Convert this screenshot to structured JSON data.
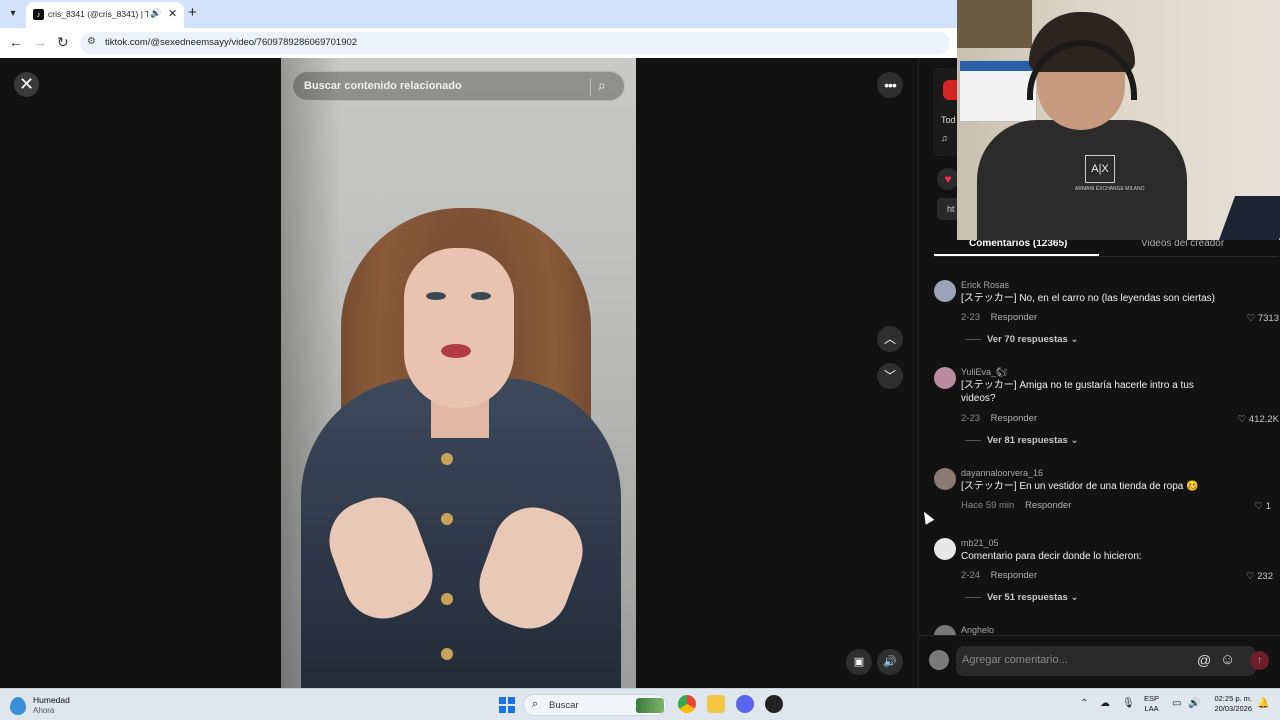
{
  "browser": {
    "tab_title": "cris_8341 (@cris_8341) | Ti",
    "url": "tiktok.com/@sexedneemsayy/video/7609789286069701902"
  },
  "viewer": {
    "search_placeholder": "Buscar contenido relacionado"
  },
  "panel": {
    "partial_text_1": "Tod",
    "partial_text_2": "♫",
    "partial_link": "ht",
    "tabs": [
      "Comentarios (12365)",
      "Videos del creador"
    ],
    "comments": [
      {
        "user": "Erick Rosas",
        "text": "[ステッカー] No, en el carro no (las leyendas son ciertas)",
        "date": "2-23",
        "reply": "Responder",
        "likes": "7313",
        "thread": "Ver 70 respuestas"
      },
      {
        "user": "YuliEva_🐿",
        "text": "[ステッカー] Amiga no te gustaría hacerle intro a tus videos?",
        "date": "2-23",
        "reply": "Responder",
        "likes": "412.2K",
        "thread": "Ver 81 respuestas"
      },
      {
        "user": "dayannaloorvera_16",
        "text": "[ステッカー] En un vestidor de una tienda de ropa 🥴",
        "date": "Hace 59 min",
        "reply": "Responder",
        "likes": "1",
        "thread": ""
      },
      {
        "user": "mb21_05",
        "text": "Comentario para decir donde lo hicieron:",
        "date": "2-24",
        "reply": "Responder",
        "likes": "232",
        "thread": "Ver 51 respuestas"
      },
      {
        "user": "Anghelo",
        "text": "",
        "date": "",
        "reply": "",
        "likes": "",
        "thread": ""
      }
    ],
    "comment_placeholder": "Agregar comentario..."
  },
  "webcam": {
    "logo_text": "A|X",
    "logo_subtext": "ARMANI EXCHANGE MILANO"
  },
  "taskbar": {
    "weather_title": "Humedad",
    "weather_sub": "Ahora",
    "search_placeholder": "Buscar",
    "lang_1": "ESP",
    "lang_2": "LAA",
    "time": "02:25 p. m.",
    "date": "20/03/2026"
  },
  "icons": {
    "close": "close-icon",
    "search": "search-icon",
    "more": "more-icon",
    "up": "chevron-up-icon",
    "down": "chevron-down-icon",
    "volume": "volume-icon",
    "heart": "heart-icon"
  },
  "colors": {
    "accent": "#fe2c55",
    "panel_bg": "#121212",
    "taskbar_bg": "#dfe6ee"
  }
}
